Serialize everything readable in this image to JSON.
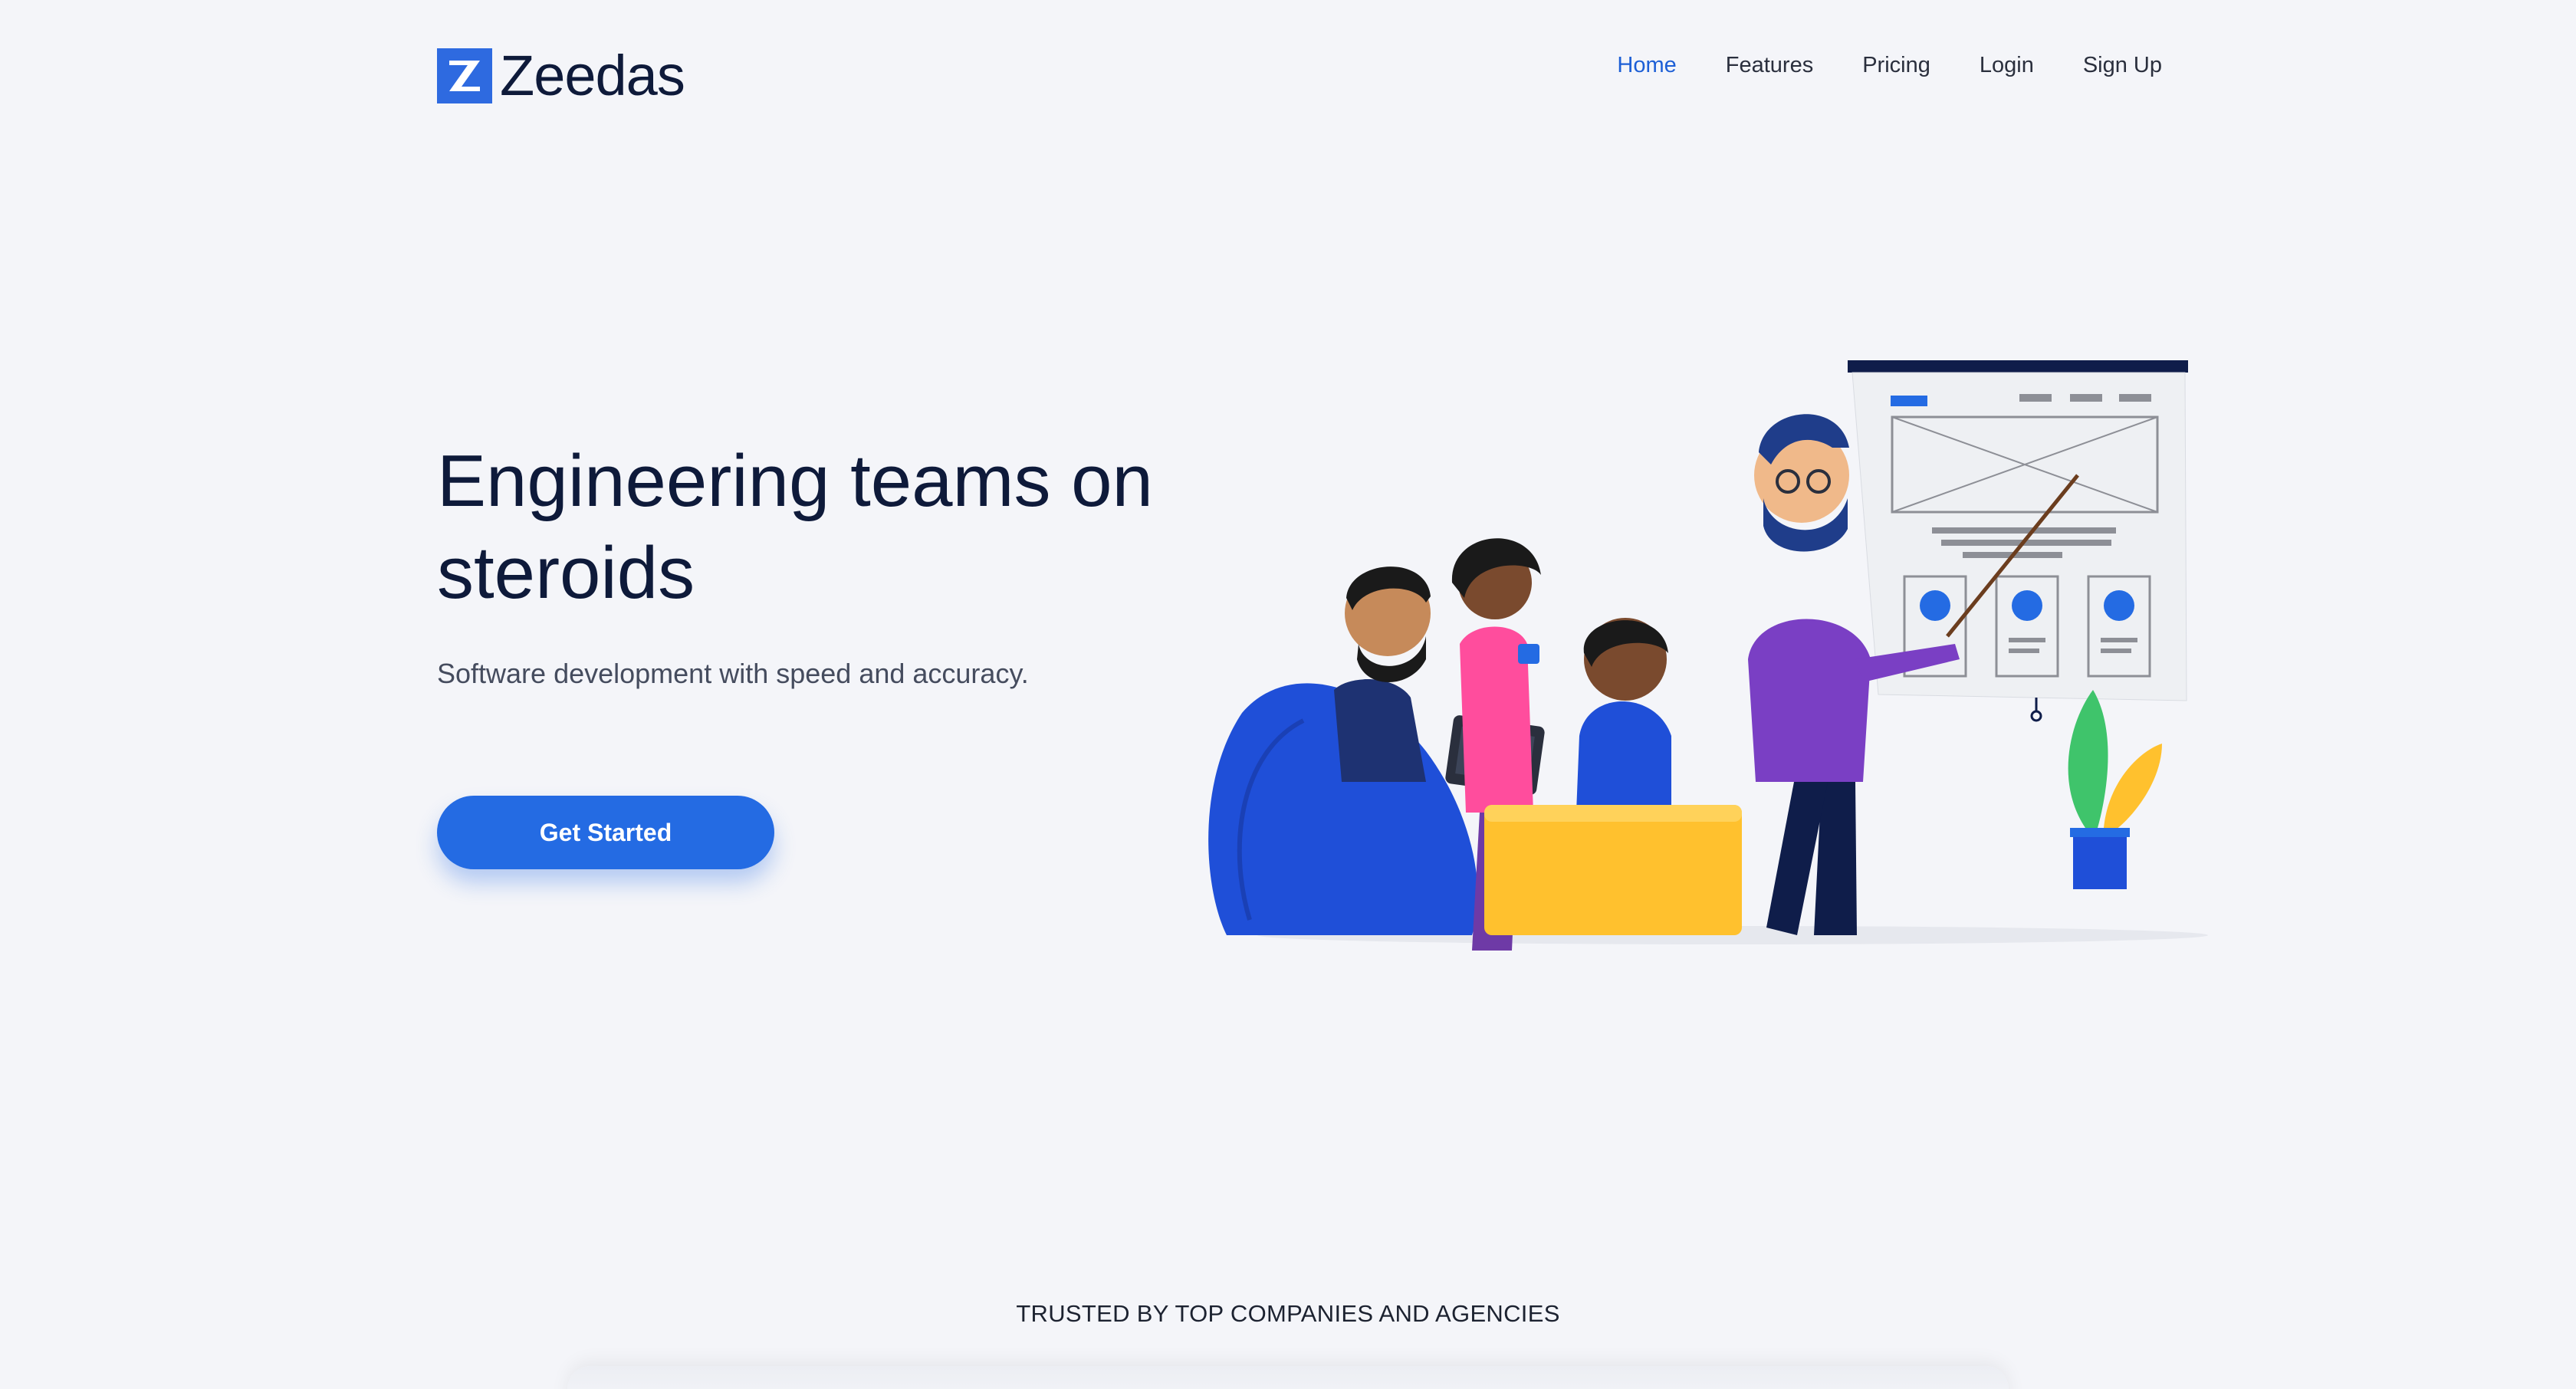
{
  "brand": {
    "name": "Zeedas",
    "logo_icon": "zeedas-z-logo-icon",
    "accent": "#2e6ae0"
  },
  "nav": {
    "items": [
      {
        "label": "Home",
        "active": true
      },
      {
        "label": "Features",
        "active": false
      },
      {
        "label": "Pricing",
        "active": false
      },
      {
        "label": "Login",
        "active": false
      },
      {
        "label": "Sign Up",
        "active": false
      }
    ],
    "active_color": "#1d5fd6"
  },
  "hero": {
    "title": "Engineering teams on steroids",
    "subtitle": "Software development with speed and accuracy.",
    "cta_label": "Get Started",
    "cta_color": "#246be3",
    "illustration": "team-meeting-whiteboard-illustration"
  },
  "trusted": {
    "heading": "TRUSTED BY TOP COMPANIES AND AGENCIES"
  },
  "colors": {
    "background": "#f4f5f9",
    "text": "#0e1a3a"
  }
}
